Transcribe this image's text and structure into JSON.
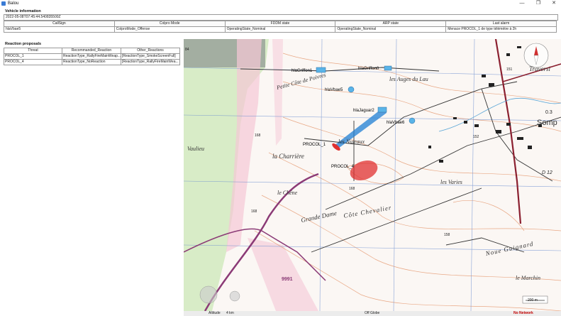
{
  "window": {
    "title": "Balou",
    "minimize": "—",
    "maximize": "❐",
    "close": "✕"
  },
  "vehicle_info": {
    "title": "Vehicle information",
    "timestamp": "2022-05-08T07:45:44.540835500Z",
    "columns": [
      "CallSign",
      "Colpro Mode",
      "FDDM state",
      "ARP state",
      "Last alarm"
    ],
    "row": [
      "hlaVbae5",
      "ColproMode_Offense",
      "OperatingState_Nominal",
      "OperatingState_Nominal",
      "Menace PROCOL_1 de type télémètre à 2h"
    ]
  },
  "reaction_proposals": {
    "title": "Reaction proposals",
    "columns": [
      "Threat",
      "Recommanded_Reaction",
      "Other_Reactions"
    ],
    "rows": [
      [
        "PROCOL_1",
        "ReactionType_RallyFireMainWeap...",
        "[ReactionType_SmokeScreenFull]"
      ],
      [
        "PROCOL_4",
        "ReactionType_NoReaction",
        "[ReactionType_RallyFireMainWea..."
      ]
    ]
  },
  "map": {
    "units": {
      "griffon": "hlaGriffon1",
      "griffon2": "hlaGriffon0",
      "vbae5": "hlaVbae5",
      "jaguar": "hlaJaguar2",
      "vbae6": "hlaVbae6",
      "procol1": "PROCOL_1",
      "procol4": "PROCOL_4"
    },
    "places": {
      "cote_poivres": "Petite Côte de Poivres",
      "auges": "les Auges du Lau",
      "nuiraux": "les Nuiraux",
      "charriere": "la Charrière",
      "vaulieu": "Vaulieu",
      "chene": "le Chêne",
      "grande_dame": "Grande Dame",
      "cote_chevalier": "Côte Chevalier",
      "varies": "les Varies",
      "traversi": "Traversi",
      "somp": "Somp",
      "noue": "Noue Guignard",
      "marchin": "le Marchin"
    },
    "elevations": {
      "a": "168",
      "b": "168",
      "c": "168",
      "d": "158",
      "e": "152",
      "f": "151",
      "g": "0.3",
      "h": "84",
      "i": "D 12",
      "j": "9991"
    },
    "scale": "200 m",
    "colors": {
      "procol1": "#1f7fd4",
      "procol4": "#e03030",
      "unit_marker": "#5ab4e8"
    }
  },
  "status_bar": {
    "altitude": "Altitude",
    "range": "4 km",
    "globe": "Off Globe",
    "network": "No Network"
  }
}
